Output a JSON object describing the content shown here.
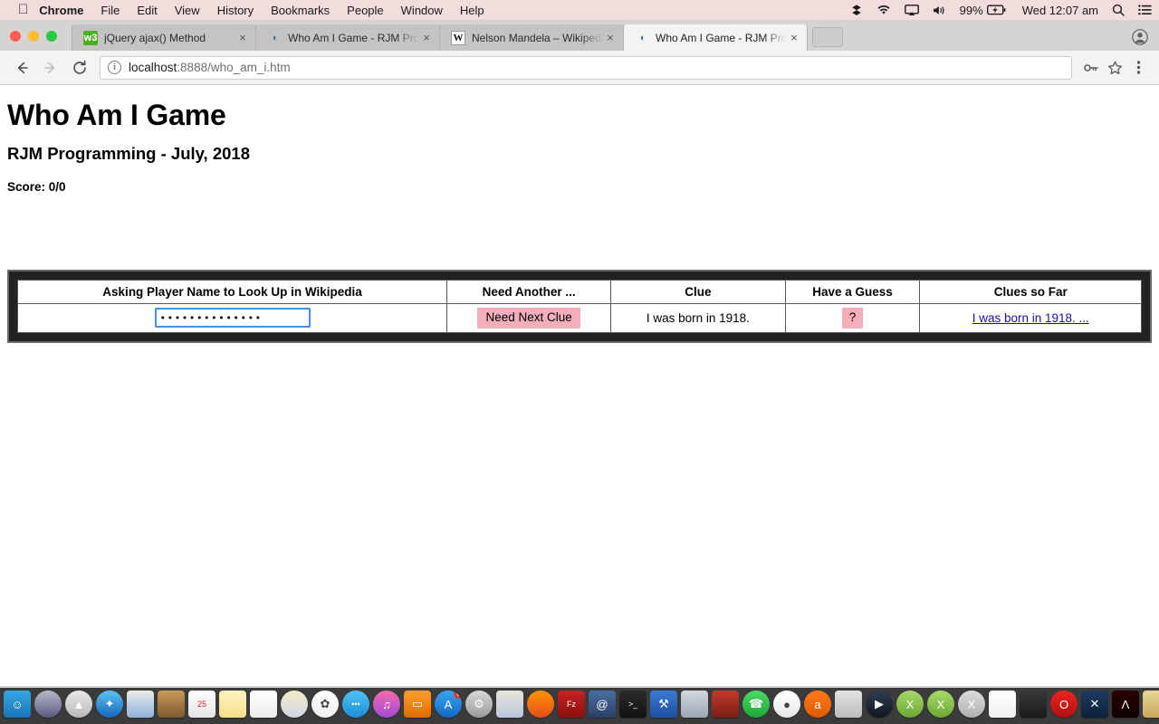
{
  "menubar": {
    "apple_icon": "apple-icon",
    "items": [
      {
        "label": "Chrome",
        "bold": true
      },
      {
        "label": "File"
      },
      {
        "label": "Edit"
      },
      {
        "label": "View"
      },
      {
        "label": "History"
      },
      {
        "label": "Bookmarks"
      },
      {
        "label": "People"
      },
      {
        "label": "Window"
      },
      {
        "label": "Help"
      }
    ],
    "status": {
      "dropbox_icon": "dropbox-icon",
      "wifi_icon": "wifi-icon",
      "airplay_icon": "airplay-icon",
      "volume_icon": "volume-icon",
      "battery_percent": "99%",
      "battery_icon": "battery-charging-icon",
      "clock": "Wed 12:07 am",
      "search_icon": "spotlight-search-icon",
      "notifications_icon": "notification-center-icon"
    }
  },
  "browser": {
    "traffic_lights": [
      "close",
      "minimize",
      "zoom"
    ],
    "tabs": [
      {
        "title": "jQuery ajax() Method",
        "favicon": "w3schools-icon",
        "active": false,
        "close_label": "×"
      },
      {
        "title": "Who Am I Game - RJM Progra",
        "favicon": "rjm-icon",
        "active": false,
        "close_label": "×"
      },
      {
        "title": "Nelson Mandela – Wikipedia",
        "favicon": "wikipedia-icon",
        "active": false,
        "close_label": "×"
      },
      {
        "title": "Who Am I Game - RJM Progra",
        "favicon": "rjm-icon",
        "active": true,
        "close_label": "×"
      }
    ],
    "new_tab_label": "",
    "toolbar": {
      "back_icon": "back-arrow-icon",
      "forward_icon": "forward-arrow-icon",
      "reload_icon": "reload-icon",
      "site_info_icon": "info-icon",
      "url_host": "localhost",
      "url_path": ":8888/who_am_i.htm",
      "url_full": "localhost:8888/who_am_i.htm",
      "password_icon": "key-icon",
      "bookmark_icon": "star-icon",
      "menu_icon": "three-dot-menu-icon"
    }
  },
  "page": {
    "title": "Who Am I Game",
    "subtitle": "RJM Programming - July, 2018",
    "score": "Score: 0/0",
    "table": {
      "headers": [
        "Asking Player Name to Look Up in Wikipedia",
        "Need Another ...",
        "Clue",
        "Have a Guess",
        "Clues so Far"
      ],
      "row": {
        "player_name_value": "••••••••••••••",
        "player_name_placeholder": "",
        "need_next_clue_label": "Need Next Clue",
        "clue_text": "I was born in 1918.",
        "have_a_guess_label": "?",
        "clues_so_far_link": "I was born in 1918. ..."
      }
    },
    "colors": {
      "pink_button": "#f3aebc",
      "link_blue": "#1a0dab",
      "frame_gray": "#6b6b6b",
      "frame_dark": "#222222",
      "focus_blue": "#4a90e2"
    }
  },
  "dock": {
    "apps": [
      {
        "name": "finder",
        "color1": "#35a8e0",
        "color2": "#1b73b8",
        "glyph": "☺",
        "running": true
      },
      {
        "name": "siri",
        "color1": "#b9b9c9",
        "color2": "#5a5a82",
        "glyph": "",
        "running": false
      },
      {
        "name": "launchpad",
        "color1": "#e9e9e9",
        "color2": "#b9b9b9",
        "glyph": "▲",
        "running": false
      },
      {
        "name": "safari",
        "color1": "#5cc3f5",
        "color2": "#1567b8",
        "glyph": "✦",
        "running": true
      },
      {
        "name": "preview",
        "color1": "#eaeaea",
        "color2": "#8fb4d8",
        "glyph": "",
        "running": false
      },
      {
        "name": "contacts",
        "color1": "#c99a5b",
        "color2": "#7c5a2d",
        "glyph": "",
        "running": false
      },
      {
        "name": "calendar",
        "color1": "#ffffff",
        "color2": "#e4e4e4",
        "glyph": "25",
        "running": false
      },
      {
        "name": "notes",
        "color1": "#fdf3c0",
        "color2": "#f4e08a",
        "glyph": "",
        "running": false
      },
      {
        "name": "reminders",
        "color1": "#ffffff",
        "color2": "#ededed",
        "glyph": "",
        "running": false
      },
      {
        "name": "photos-editor",
        "color1": "#f2e9c8",
        "color2": "#cdd7e4",
        "glyph": "",
        "running": false
      },
      {
        "name": "photos",
        "color1": "#ffffff",
        "color2": "#f0f0f0",
        "glyph": "✿",
        "running": false
      },
      {
        "name": "messages",
        "color1": "#4fc3f7",
        "color2": "#1a8fd6",
        "glyph": "•••",
        "running": false
      },
      {
        "name": "itunes",
        "color1": "#f26ba8",
        "color2": "#a24ad6",
        "glyph": "♫",
        "running": false
      },
      {
        "name": "ibooks",
        "color1": "#ff9d2e",
        "color2": "#e06b00",
        "glyph": "▭",
        "running": false
      },
      {
        "name": "app-store",
        "color1": "#3aa6f0",
        "color2": "#1166c4",
        "glyph": "A",
        "running": false,
        "badge": "8"
      },
      {
        "name": "system-preferences",
        "color1": "#d8d8d8",
        "color2": "#9a9a9a",
        "glyph": "⚙",
        "running": false
      },
      {
        "name": "paint-app",
        "color1": "#e8e4da",
        "color2": "#b7c8da",
        "glyph": "",
        "running": true
      },
      {
        "name": "firefox",
        "color1": "#ff9500",
        "color2": "#e24e1b",
        "glyph": "",
        "running": true
      },
      {
        "name": "filezilla",
        "color1": "#c62222",
        "color2": "#8c0f0f",
        "glyph": "Fz",
        "running": true
      },
      {
        "name": "mamp",
        "color1": "#4a6fa5",
        "color2": "#2b3f66",
        "glyph": "@",
        "running": true
      },
      {
        "name": "terminal",
        "color1": "#2b2b2b",
        "color2": "#111111",
        "glyph": ">_",
        "running": true
      },
      {
        "name": "xcode",
        "color1": "#3a7bd5",
        "color2": "#1d4f9e",
        "glyph": "⚒",
        "running": false
      },
      {
        "name": "finder-folder",
        "color1": "#d3d9df",
        "color2": "#9aa6b2",
        "glyph": "",
        "running": true
      },
      {
        "name": "red-app",
        "color1": "#c0392b",
        "color2": "#7c1f16",
        "glyph": "",
        "running": false
      },
      {
        "name": "facetime",
        "color1": "#4cd964",
        "color2": "#1fa637",
        "glyph": "☎",
        "running": false
      },
      {
        "name": "chrome",
        "color1": "#ffffff",
        "color2": "#e8e8e8",
        "glyph": "●",
        "running": true
      },
      {
        "name": "avast",
        "color1": "#ff7a1a",
        "color2": "#e05a00",
        "glyph": "a",
        "running": false
      },
      {
        "name": "gimp-disabled",
        "color1": "#e3e3e3",
        "color2": "#bcbcbc",
        "glyph": "",
        "running": true
      },
      {
        "name": "quicktime",
        "color1": "#2d3e50",
        "color2": "#101820",
        "glyph": "▶",
        "running": false
      },
      {
        "name": "xquartz-1",
        "color1": "#a8d96b",
        "color2": "#6aa832",
        "glyph": "X",
        "running": false
      },
      {
        "name": "xquartz-2",
        "color1": "#a8d96b",
        "color2": "#6aa832",
        "glyph": "X",
        "running": false
      },
      {
        "name": "xquartz-3",
        "color1": "#dcdcdc",
        "color2": "#b0b0b0",
        "glyph": "X",
        "running": true
      },
      {
        "name": "blank-document",
        "color1": "#ffffff",
        "color2": "#f0f0f0",
        "glyph": "",
        "running": false
      },
      {
        "name": "inkscape",
        "color1": "#3a3a3a",
        "color2": "#1a1a1a",
        "glyph": "",
        "running": false
      },
      {
        "name": "opera",
        "color1": "#ee2222",
        "color2": "#b01010",
        "glyph": "O",
        "running": true
      },
      {
        "name": "vs-code",
        "color1": "#1e3a5f",
        "color2": "#0d213a",
        "glyph": "✕",
        "running": false
      },
      {
        "name": "acrobat",
        "color1": "#2b0000",
        "color2": "#110000",
        "glyph": "Λ",
        "running": false
      },
      {
        "name": "stickies",
        "color1": "#e8d79a",
        "color2": "#c9a85a",
        "glyph": "",
        "running": true
      }
    ],
    "minimized_windows": [
      {
        "name": "minimized-window-1"
      },
      {
        "name": "minimized-window-2"
      },
      {
        "name": "minimized-window-3"
      },
      {
        "name": "minimized-window-4"
      },
      {
        "name": "minimized-window-5"
      }
    ],
    "trash": {
      "name": "trash-icon"
    }
  }
}
